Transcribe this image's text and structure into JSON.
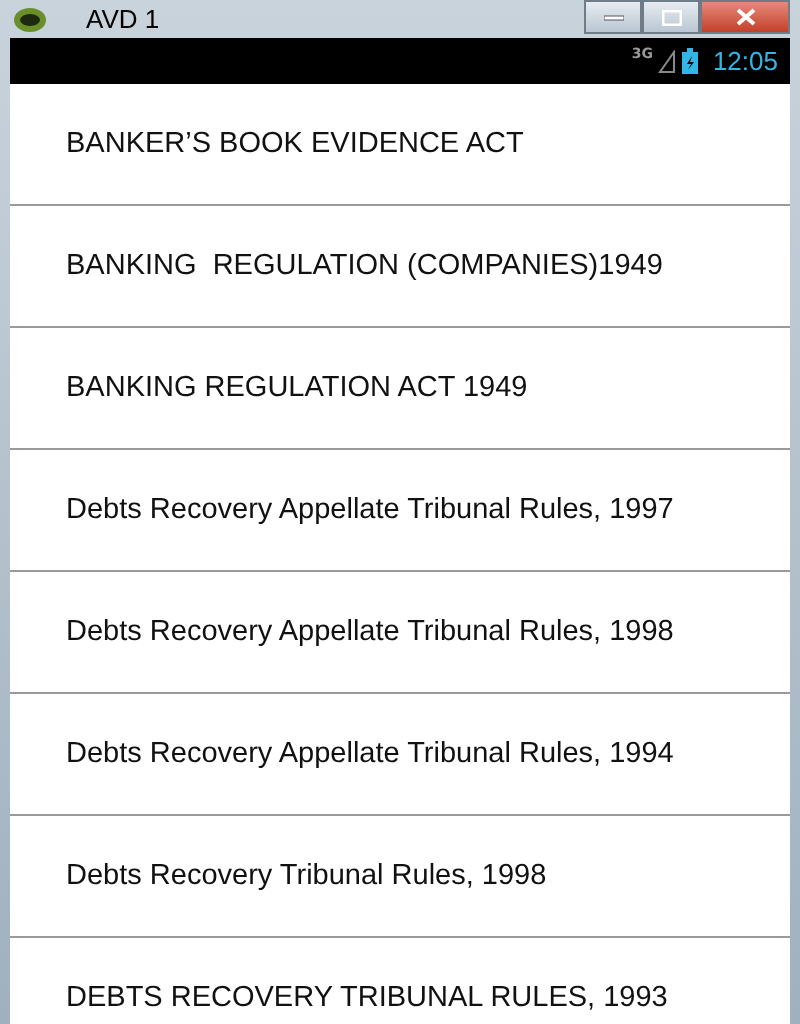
{
  "window": {
    "title": "AVD 1"
  },
  "status_bar": {
    "network": "3G",
    "time": "12:05"
  },
  "list": [
    {
      "label": "BANKER’S BOOK EVIDENCE ACT"
    },
    {
      "label": "BANKING  REGULATION (COMPANIES)1949"
    },
    {
      "label": "BANKING REGULATION ACT 1949"
    },
    {
      "label": "Debts Recovery Appellate Tribunal Rules, 1997"
    },
    {
      "label": "Debts Recovery Appellate Tribunal Rules, 1998"
    },
    {
      "label": "Debts Recovery Appellate Tribunal Rules, 1994"
    },
    {
      "label": "Debts Recovery Tribunal Rules, 1998"
    },
    {
      "label": "DEBTS RECOVERY TRIBUNAL RULES, 1993"
    }
  ]
}
